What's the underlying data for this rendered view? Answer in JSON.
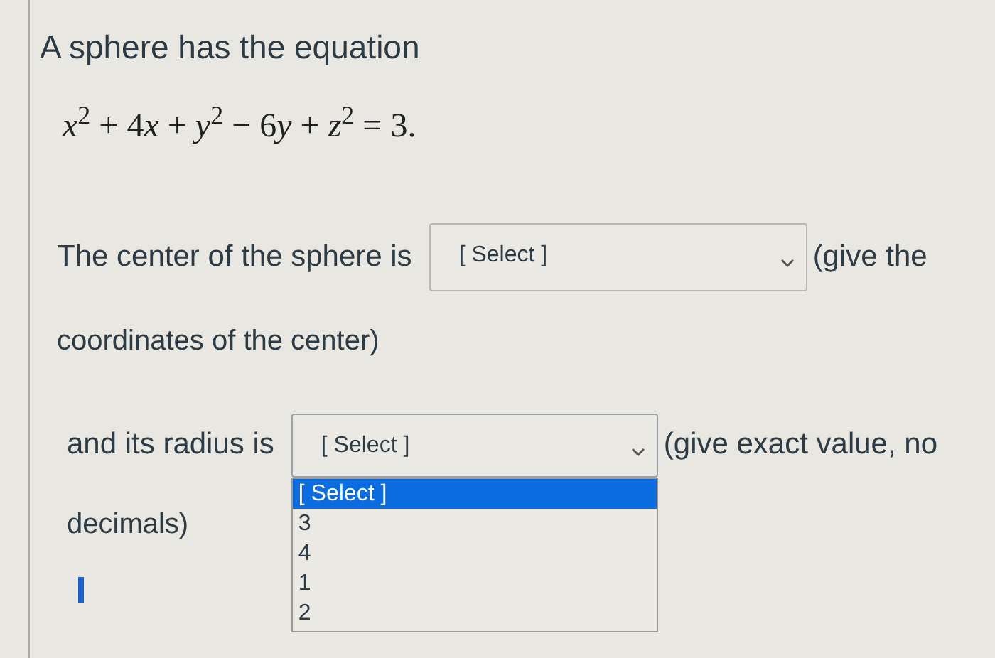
{
  "question": {
    "prompt": "A sphere has the equation",
    "equation": [
      "*x*$^{2}$ + 4",
      "*x*",
      " + *y*$^{2}$ − 6",
      "*y*",
      " + *z*$^{2}$ = 3."
    ],
    "parts": [
      {
        "before": "The center of the sphere is",
        "select": {
          "value": "[ Select ]",
          "expanded": false
        },
        "after": "(give the",
        "continuation": "coordinates of the center)"
      },
      {
        "before": "and its radius is",
        "select": {
          "value": "[ Select ]",
          "expanded": true,
          "options": [
            {
              "label": "[ Select ]",
              "selected": true
            },
            {
              "label": "3",
              "selected": false
            },
            {
              "label": "4",
              "selected": false
            },
            {
              "label": "1",
              "selected": false
            },
            {
              "label": "2",
              "selected": false
            }
          ]
        },
        "after": "(give exact value, no",
        "continuation": "decimals)"
      }
    ]
  }
}
